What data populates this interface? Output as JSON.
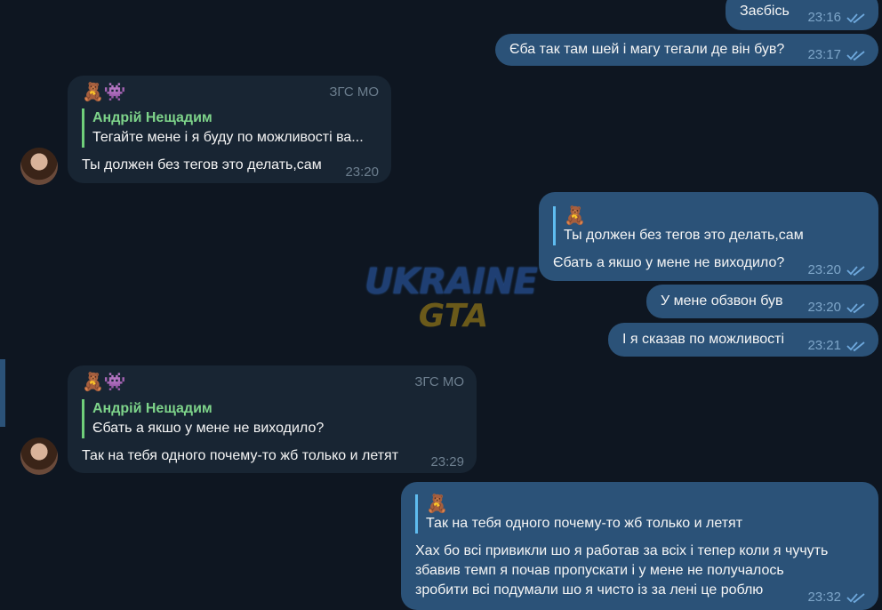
{
  "messages": [
    {
      "text": "Заєбісь",
      "time": "23:16"
    },
    {
      "text": "Єба так там шей і магу тегали де він був?",
      "time": "23:17"
    },
    {
      "sender_tag": "ЗГС МО",
      "sender_emojis": "🧸👾",
      "reply_name": "Андрій Нещадим",
      "reply_text": "Тегайте мене і я буду по можливості ва...",
      "text": "Ты должен без тегов это делать,сам",
      "time": "23:20"
    },
    {
      "reply_emoji": "🧸",
      "reply_text": "Ты должен без тегов это делать,сам",
      "text": "Єбать а якшо у мене не виходило?",
      "time": "23:20"
    },
    {
      "text": "У мене обзвон був",
      "time": "23:20"
    },
    {
      "text": "І я сказав по можливості",
      "time": "23:21"
    },
    {
      "sender_tag": "ЗГС МО",
      "sender_emojis": "🧸👾",
      "reply_name": "Андрій Нещадим",
      "reply_text": "Єбать а якшо у мене не виходило?",
      "text": "Так на тебя одного почему-то жб только и летят",
      "time": "23:29"
    },
    {
      "reply_emoji": "🧸",
      "reply_text": "Так на тебя одного почему-то жб только и летят",
      "lines": [
        "Хах бо всі привикли шо я работав за всіх і тепер коли я чучуть",
        "збавив темп я почав пропускати і у мене не получалось",
        "зробити всі подумали шо я чисто із за лені це роблю"
      ],
      "time": "23:32"
    }
  ],
  "watermark": {
    "line1": "UKRAINE",
    "line2": "GTA"
  },
  "colors": {
    "background": "#0e1621",
    "incoming": "#182533",
    "outgoing": "#2b5278",
    "reply_name": "#7ed48a"
  },
  "icons": {
    "read_status": "double-check-icon"
  }
}
